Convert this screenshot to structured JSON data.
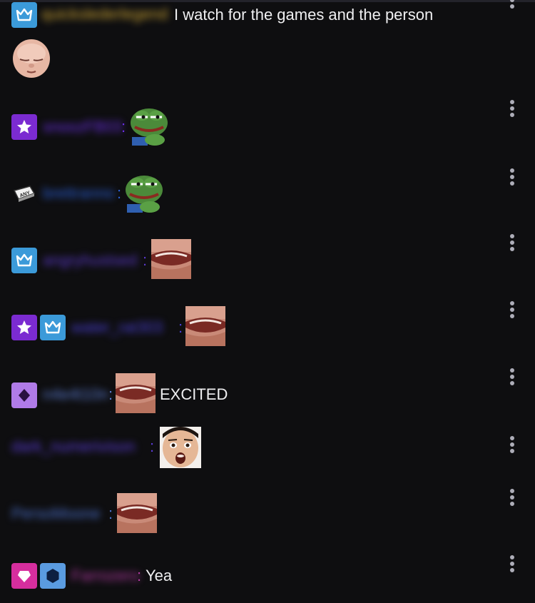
{
  "colors": {
    "background": "#0e0e10",
    "text": "#efeff1",
    "crown_badge": "#3b9ad9",
    "star_badge": "#7b2bd1",
    "gem_badge": "#b07be8",
    "heart_badge": "#d62e9e",
    "hex_badge": "#5a9be0"
  },
  "messages": [
    {
      "badges": [
        "crown"
      ],
      "username": "quickslederlegend",
      "name_color": "#c9a233",
      "text": "I watch for the games and the person"
    },
    {
      "emote": "bald-head-emote"
    },
    {
      "badges": [
        "star"
      ],
      "username": "snoozFB03",
      "name_color": "#6b2ee6",
      "colon": ":",
      "emote": "pepe-frog-emote"
    },
    {
      "badges": [
        "any-key"
      ],
      "username": "brettranno",
      "name_color": "#2a5fd6",
      "colon": ":",
      "emote": "pepe-frog-emote"
    },
    {
      "badges": [
        "crown"
      ],
      "username": "angryhustsed",
      "name_color": "#5a38c9",
      "colon": ":",
      "emote": "mouth-emote"
    },
    {
      "badges": [
        "star",
        "crown"
      ],
      "username": "water_rat303",
      "name_color": "#4a3fd6",
      "colon": ":",
      "emote": "mouth-emote"
    },
    {
      "badges": [
        "gem"
      ],
      "username": "n4e4t10n",
      "name_color": "#5a7bcf",
      "colon": ":",
      "emote": "mouth-emote",
      "text": "EXCITED"
    },
    {
      "username": "dark_numerivison",
      "name_color": "#5a3bd6",
      "colon": ":",
      "emote": "surprised-face-emote"
    },
    {
      "username": "PersoMoone",
      "name_color": "#4a6fc9",
      "colon": ":",
      "emote": "mouth-emote"
    },
    {
      "badges": [
        "heart",
        "hex"
      ],
      "username": "Farrozero",
      "name_color": "#b33aa3",
      "colon": ":",
      "text": "Yea"
    }
  ]
}
